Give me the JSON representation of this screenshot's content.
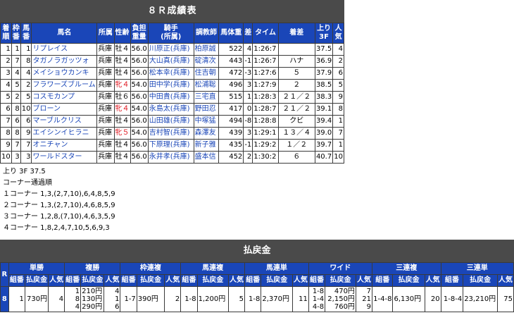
{
  "results": {
    "title": "８Ｒ成績表",
    "headers": [
      "着順",
      "枠番",
      "馬番",
      "馬名",
      "所属",
      "性齢",
      "負担重量",
      "騎手(所属)",
      "調教師",
      "馬体重",
      "差",
      "タイム",
      "着差",
      "上り3F",
      "人気"
    ],
    "header_lines": {
      "rank": [
        "着",
        "順"
      ],
      "frame": [
        "枠",
        "番"
      ],
      "num": [
        "馬",
        "番"
      ],
      "name": "馬名",
      "belong": "所属",
      "sexage": "性齢",
      "weight": [
        "負担",
        "重量"
      ],
      "jockey": [
        "騎手",
        "(所属)"
      ],
      "trainer": "調教師",
      "body": "馬体重",
      "diff": "差",
      "time": "タイム",
      "margin": "着差",
      "last3f": [
        "上り",
        "3F"
      ],
      "pop": [
        "人",
        "気"
      ]
    },
    "rows": [
      {
        "rank": "1",
        "frame": "1",
        "num": "1",
        "name": "リプレイス",
        "belong": "兵庫",
        "sexage": "牡４",
        "sexage_red": false,
        "weight": "56.0",
        "jockey": "川原正(兵庫)",
        "trainer": "柏原誠",
        "body": "522",
        "diff": "4",
        "time": "1:26:7",
        "margin": "",
        "last3f": "37.5",
        "pop": "4"
      },
      {
        "rank": "2",
        "frame": "7",
        "num": "8",
        "name": "タガノラガッツォ",
        "belong": "兵庫",
        "sexage": "牡４",
        "sexage_red": false,
        "weight": "56.0",
        "jockey": "大山真(兵庫)",
        "trainer": "碇清次",
        "body": "443",
        "diff": "-1",
        "time": "1:26:7",
        "margin": "ハナ",
        "last3f": "36.9",
        "pop": "2"
      },
      {
        "rank": "3",
        "frame": "4",
        "num": "4",
        "name": "メイショウカンキ",
        "belong": "兵庫",
        "sexage": "牡４",
        "sexage_red": false,
        "weight": "56.0",
        "jockey": "松本幸(兵庫)",
        "trainer": "住吉朝",
        "body": "472",
        "diff": "-3",
        "time": "1:27:6",
        "margin": "５",
        "last3f": "37.9",
        "pop": "6"
      },
      {
        "rank": "4",
        "frame": "5",
        "num": "2",
        "name": "フラワーズブルーム",
        "belong": "兵庫",
        "sexage": "牝４",
        "sexage_red": true,
        "weight": "54.0",
        "jockey": "田中学(兵庫)",
        "trainer": "松浦聡",
        "body": "496",
        "diff": "3",
        "time": "1:27:9",
        "margin": "２",
        "last3f": "38.5",
        "pop": "5"
      },
      {
        "rank": "5",
        "frame": "2",
        "num": "5",
        "name": "コスモカンプ",
        "belong": "兵庫",
        "sexage": "牡６",
        "sexage_red": false,
        "weight": "56.0",
        "jockey": "中田貴(兵庫)",
        "trainer": "三宅直",
        "body": "515",
        "diff": "1",
        "time": "1:28:3",
        "margin": "２１／２",
        "last3f": "38.3",
        "pop": "9"
      },
      {
        "rank": "6",
        "frame": "8",
        "num": "10",
        "name": "ブローン",
        "belong": "兵庫",
        "sexage": "牝４",
        "sexage_red": true,
        "weight": "54.0",
        "jockey": "永島太(兵庫)",
        "trainer": "野田忍",
        "body": "417",
        "diff": "0",
        "time": "1:28:7",
        "margin": "２１／２",
        "last3f": "39.1",
        "pop": "8"
      },
      {
        "rank": "7",
        "frame": "6",
        "num": "6",
        "name": "マーブルクリス",
        "belong": "兵庫",
        "sexage": "牡４",
        "sexage_red": false,
        "weight": "56.0",
        "jockey": "山田雄(兵庫)",
        "trainer": "中塚猛",
        "body": "494",
        "diff": "-8",
        "time": "1:28:8",
        "margin": "クビ",
        "last3f": "39.4",
        "pop": "1"
      },
      {
        "rank": "8",
        "frame": "8",
        "num": "9",
        "name": "エイシンイヒラニ",
        "belong": "兵庫",
        "sexage": "牝５",
        "sexage_red": true,
        "weight": "54.0",
        "jockey": "吉村智(兵庫)",
        "trainer": "森澤友",
        "body": "439",
        "diff": "3",
        "time": "1:29:1",
        "margin": "１３／４",
        "last3f": "39.0",
        "pop": "7"
      },
      {
        "rank": "9",
        "frame": "7",
        "num": "7",
        "name": "オニチャン",
        "belong": "兵庫",
        "sexage": "牡４",
        "sexage_red": false,
        "weight": "56.0",
        "jockey": "下原理(兵庫)",
        "trainer": "新子雅",
        "body": "435",
        "diff": "-1",
        "time": "1:29:2",
        "margin": "１／２",
        "last3f": "39.7",
        "pop": "1"
      },
      {
        "rank": "10",
        "frame": "3",
        "num": "3",
        "name": "ワールドスター",
        "belong": "兵庫",
        "sexage": "牡４",
        "sexage_red": false,
        "weight": "56.0",
        "jockey": "永井孝(兵庫)",
        "trainer": "盛本信",
        "body": "452",
        "diff": "2",
        "time": "1:30:2",
        "margin": "６",
        "last3f": "40.7",
        "pop": "10"
      }
    ]
  },
  "notes": {
    "last3f": "上り 3F 37.5",
    "corner_title": "コーナー通過順",
    "corners": [
      "１コーナー 1,3,(2,7,10),6,4,8,5,9",
      "２コーナー 1,3,(2,7,10),4,6,8,5,9",
      "３コーナー 1,2,8,(7,10),4,6,3,5,9",
      "４コーナー 1,8,2,4,7,10,5,6,9,3"
    ]
  },
  "payout": {
    "title": "払戻金",
    "race_label": "R",
    "race": "8",
    "groups": [
      "単勝",
      "複勝",
      "枠連複",
      "馬連複",
      "馬連単",
      "ワイド",
      "三連複",
      "三連単"
    ],
    "sub": {
      "combo": "組番",
      "amount": "払戻金",
      "pop": "人気"
    },
    "tansho": {
      "combo": "1",
      "amount": "730円",
      "pop": "4"
    },
    "fukusho": [
      {
        "combo": "1",
        "amount": "210円",
        "pop": "4"
      },
      {
        "combo": "8",
        "amount": "130円",
        "pop": "1"
      },
      {
        "combo": "4",
        "amount": "290円",
        "pop": "6"
      }
    ],
    "wakuren": {
      "combo": "1-7",
      "amount": "390円",
      "pop": "2"
    },
    "umaren": {
      "combo": "1-8",
      "amount": "1,200円",
      "pop": "5"
    },
    "umatan": {
      "combo": "1-8",
      "amount": "2,370円",
      "pop": "11"
    },
    "wide": [
      {
        "combo": "1-8",
        "amount": "470円",
        "pop": "7"
      },
      {
        "combo": "1-4",
        "amount": "2,150円",
        "pop": "21"
      },
      {
        "combo": "4-8",
        "amount": "760円",
        "pop": "9"
      }
    ],
    "sanrenpuku": {
      "combo": "1-4-8",
      "amount": "6,130円",
      "pop": "20"
    },
    "sanrentan": {
      "combo": "1-8-4",
      "amount": "23,210円",
      "pop": "75"
    }
  },
  "colors": {
    "header_blue": "#1a46b8",
    "title_gray": "#4a4a4a",
    "red": "#e0151f"
  }
}
